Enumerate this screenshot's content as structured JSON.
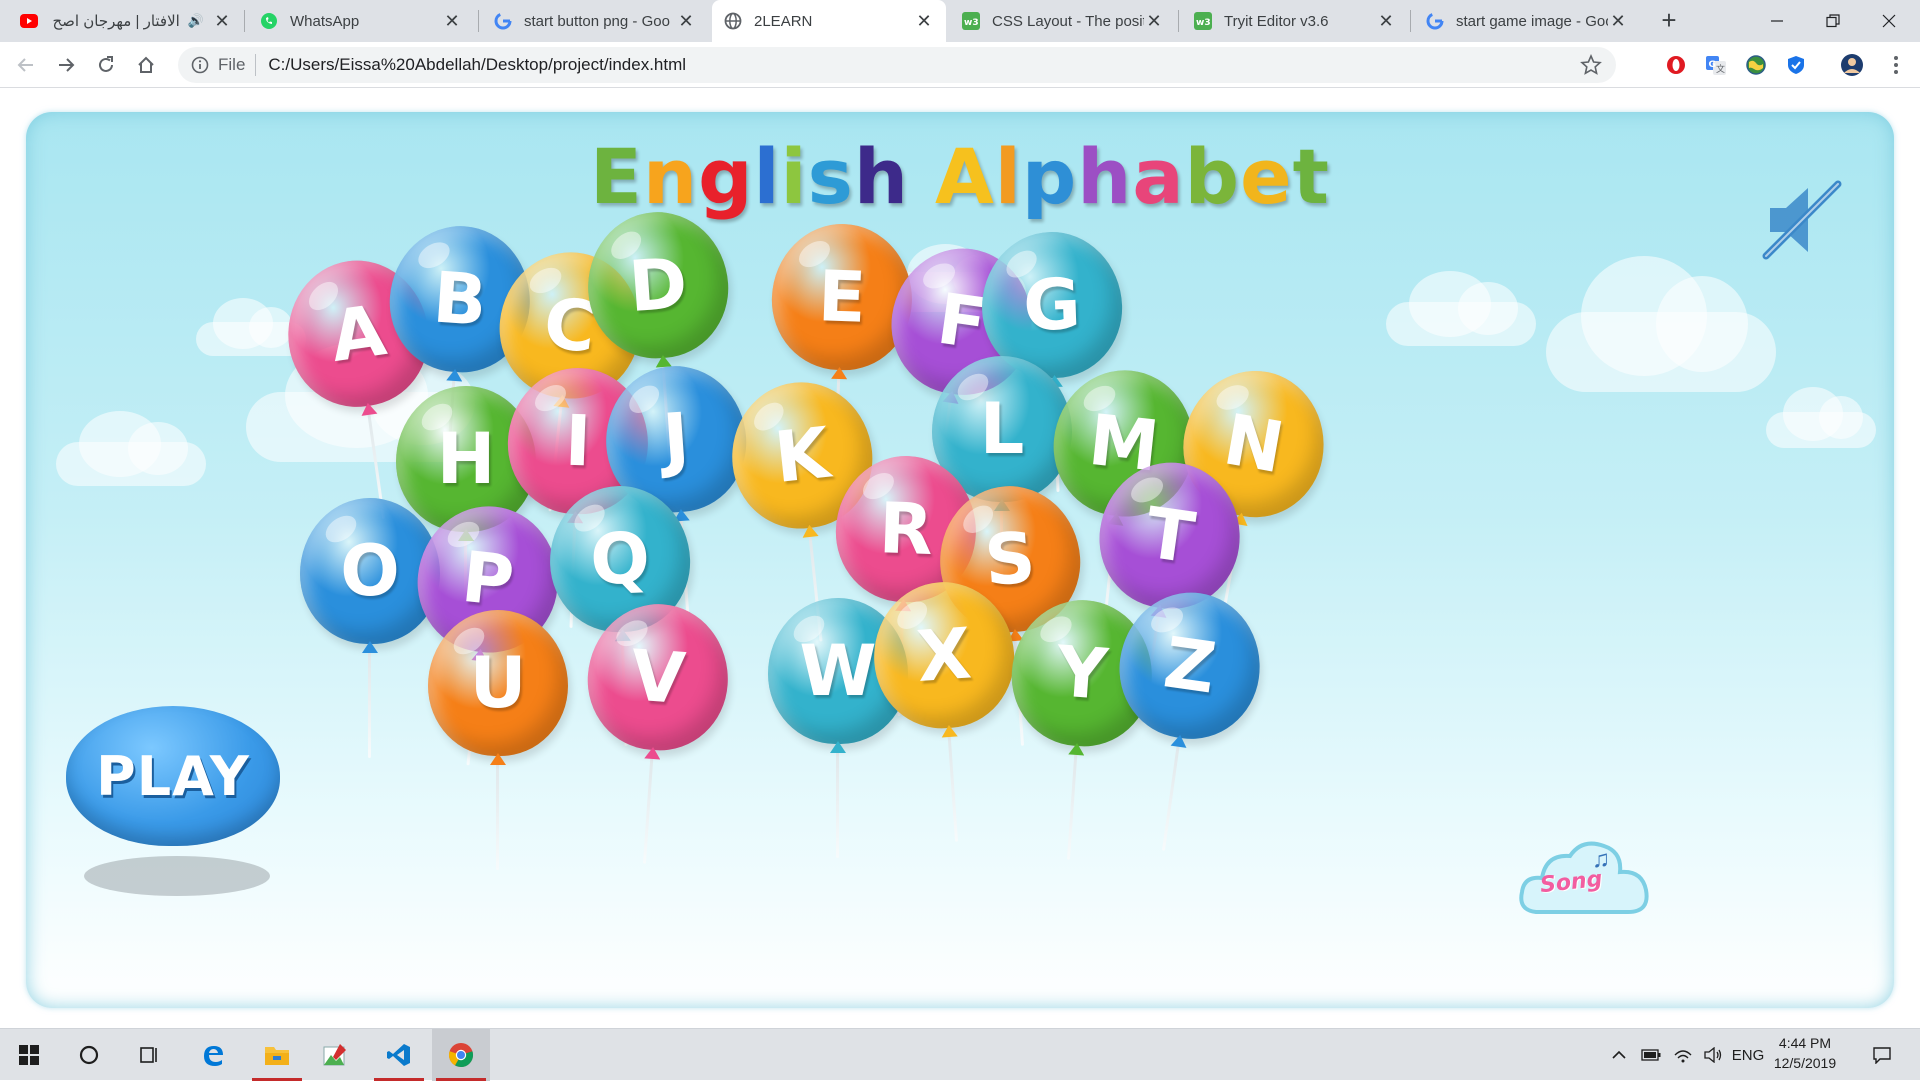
{
  "browser": {
    "tabs": [
      {
        "title": "الافتار | مهرجان اصح",
        "icon": "youtube-icon",
        "audio": true
      },
      {
        "title": "WhatsApp",
        "icon": "whatsapp-icon"
      },
      {
        "title": "start button png - Goo",
        "icon": "google-icon"
      },
      {
        "title": "2LEARN",
        "icon": "globe-icon",
        "active": true
      },
      {
        "title": "CSS Layout - The positi",
        "icon": "w3schools-icon"
      },
      {
        "title": "Tryit Editor v3.6",
        "icon": "w3schools-icon"
      },
      {
        "title": "start game image - Goo",
        "icon": "google-icon"
      }
    ],
    "address": {
      "scheme": "File",
      "url": "C:/Users/Eissa%20Abdellah/Desktop/project/index.html"
    },
    "extensions": [
      "opera-adblock-icon",
      "google-translate-icon",
      "earth-icon",
      "shield-icon",
      "profile-avatar-icon"
    ]
  },
  "game": {
    "title_word1": [
      "E",
      "n",
      "g",
      "l",
      "i",
      "s",
      "h"
    ],
    "title_word2": [
      "A",
      "l",
      "p",
      "h",
      "a",
      "b",
      "e",
      "t"
    ],
    "title_colors": [
      "#6db33f",
      "#f7a41d",
      "#e8212b",
      "#2c6fd1",
      "#8dc63f",
      "#2e9bd6",
      "#3d2a8a",
      "#f6c11e",
      "#f29b21",
      "#2e8fd6",
      "#9c4fc4",
      "#e8457a",
      "#7bb53a",
      "#f1b51c"
    ],
    "play_label": "PLAY",
    "song_label": "Song",
    "mute_icon": "speaker-muted-icon",
    "balloons": [
      {
        "letter": "A",
        "color": "#ec4c8e"
      },
      {
        "letter": "B",
        "color": "#2a8fdc"
      },
      {
        "letter": "C",
        "color": "#f8b81f"
      },
      {
        "letter": "D",
        "color": "#56b631"
      },
      {
        "letter": "E",
        "color": "#f57f17"
      },
      {
        "letter": "F",
        "color": "#a64fd6"
      },
      {
        "letter": "G",
        "color": "#33b2cc"
      },
      {
        "letter": "H",
        "color": "#56b631"
      },
      {
        "letter": "I",
        "color": "#ec4c8e"
      },
      {
        "letter": "J",
        "color": "#2a8fdc"
      },
      {
        "letter": "K",
        "color": "#f8b81f"
      },
      {
        "letter": "L",
        "color": "#33b2cc"
      },
      {
        "letter": "M",
        "color": "#56b631"
      },
      {
        "letter": "N",
        "color": "#f8b81f"
      },
      {
        "letter": "O",
        "color": "#2a8fdc"
      },
      {
        "letter": "P",
        "color": "#a64fd6"
      },
      {
        "letter": "Q",
        "color": "#33b2cc"
      },
      {
        "letter": "R",
        "color": "#ec4c8e"
      },
      {
        "letter": "S",
        "color": "#f57f17"
      },
      {
        "letter": "T",
        "color": "#a64fd6"
      },
      {
        "letter": "U",
        "color": "#f57f17"
      },
      {
        "letter": "V",
        "color": "#ec4c8e"
      },
      {
        "letter": "W",
        "color": "#33b2cc"
      },
      {
        "letter": "X",
        "color": "#f8b81f"
      },
      {
        "letter": "Y",
        "color": "#56b631"
      },
      {
        "letter": "Z",
        "color": "#2a8fdc"
      }
    ]
  },
  "taskbar": {
    "apps": [
      "windows-start-icon",
      "cortana-search-icon",
      "task-view-icon",
      "edge-icon",
      "file-explorer-icon",
      "paint-icon",
      "vscode-icon",
      "chrome-icon"
    ],
    "language": "ENG",
    "time": "4:44 PM",
    "date": "12/5/2019"
  }
}
